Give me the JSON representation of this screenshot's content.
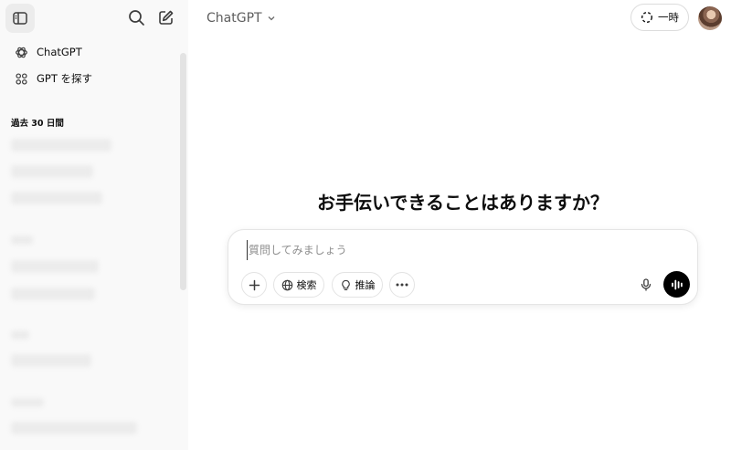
{
  "sidebar": {
    "items": [
      {
        "label": "ChatGPT",
        "icon": "openai-logo-icon"
      },
      {
        "label": "GPT を探す",
        "icon": "grid-icon"
      }
    ],
    "section_title": "過去 30 日間"
  },
  "header": {
    "model_name": "ChatGPT",
    "temporary_label": "一時"
  },
  "main": {
    "headline": "お手伝いできることはありますか？",
    "composer": {
      "placeholder": "質問してみましょう",
      "search_label": "検索",
      "reason_label": "推論"
    }
  },
  "colors": {
    "sidebar_bg": "#f9f9f9",
    "voice_button_bg": "#000000"
  }
}
